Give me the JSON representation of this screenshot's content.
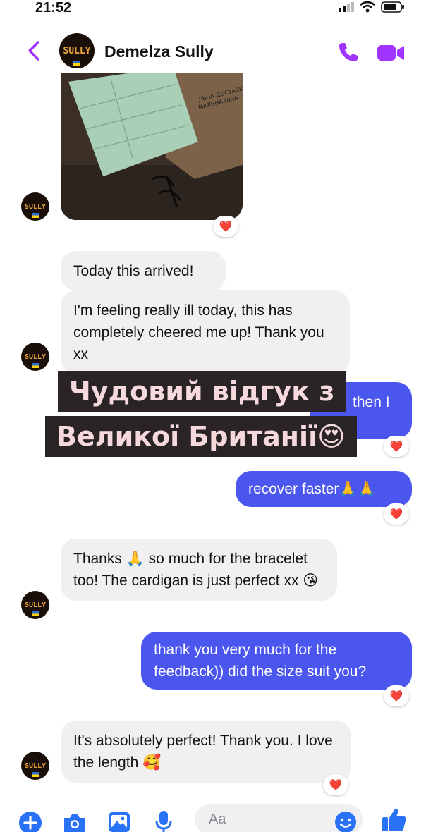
{
  "status_bar": {
    "time": "21:52"
  },
  "header": {
    "contact_name": "Demelza Sully",
    "avatar_text": "SULLY"
  },
  "photo": {
    "label_lines": [
      "ЛЬНА ДОСТАВКА",
      "МАЛЬНА ЦІНА"
    ]
  },
  "messages": [
    {
      "id": "m1",
      "direction": "in",
      "text": "Today this arrived!"
    },
    {
      "id": "m2",
      "direction": "in",
      "text": "I'm feeling really ill today, this has completely cheered me up! Thank you xx"
    },
    {
      "id": "m3",
      "direction": "out",
      "text": "then I"
    },
    {
      "id": "m4",
      "direction": "out",
      "text": "recover faster🙏🙏"
    },
    {
      "id": "m5",
      "direction": "in",
      "text": "Thanks 🙏 so much for the bracelet too! The cardigan is just perfect xx 😘"
    },
    {
      "id": "m6",
      "direction": "out",
      "text": "thank you very much for the feedback)) did the size suit you?"
    },
    {
      "id": "m7",
      "direction": "in",
      "text": "It's absolutely perfect! Thank you. I love the length 🥰"
    }
  ],
  "reaction": "❤️",
  "overlay": {
    "line1": "Чудовий відгук з",
    "line2": "Великої Британії😍"
  },
  "composer": {
    "placeholder": "Aa"
  },
  "colors": {
    "accent": "#a033ff",
    "outgoing": "#4a56ee",
    "incoming": "#f0f0f2"
  },
  "icons": [
    "back-chevron-icon",
    "phone-icon",
    "video-camera-icon",
    "plus-icon",
    "camera-icon",
    "gallery-icon",
    "microphone-icon",
    "emoji-icon",
    "thumbs-up-icon"
  ]
}
